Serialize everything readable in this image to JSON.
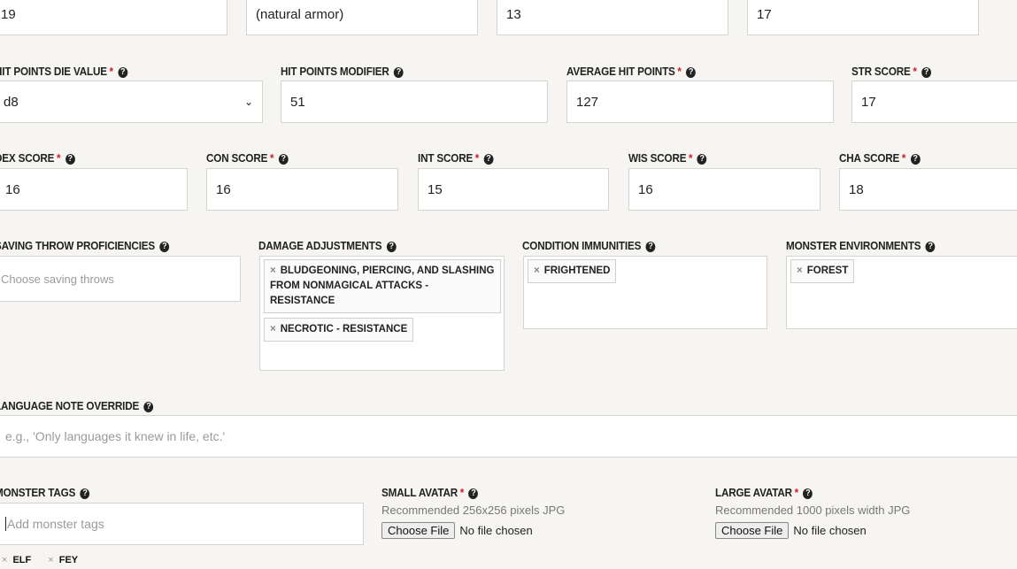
{
  "row0": {
    "values": [
      "19",
      "(natural armor)",
      "13",
      "17"
    ]
  },
  "hit_die": {
    "label": "HIT POINTS DIE VALUE",
    "value": "d8"
  },
  "hp_mod": {
    "label": "HIT POINTS MODIFIER",
    "value": "51"
  },
  "avg_hp": {
    "label": "AVERAGE HIT POINTS",
    "value": "127"
  },
  "str": {
    "label": "STR SCORE",
    "value": "17"
  },
  "dex": {
    "label": "DEX SCORE",
    "value": "16"
  },
  "con": {
    "label": "CON SCORE",
    "value": "16"
  },
  "int": {
    "label": "INT SCORE",
    "value": "15"
  },
  "wis": {
    "label": "WIS SCORE",
    "value": "16"
  },
  "cha": {
    "label": "CHA SCORE",
    "value": "18"
  },
  "saving": {
    "label": "SAVING THROW PROFICIENCIES",
    "placeholder": "Choose saving throws"
  },
  "damage": {
    "label": "DAMAGE ADJUSTMENTS",
    "tags": [
      "BLUDGEONING, PIERCING, AND SLASHING FROM NONMAGICAL ATTACKS - RESISTANCE",
      "NECROTIC - RESISTANCE"
    ]
  },
  "conditions": {
    "label": "CONDITION IMMUNITIES",
    "tags": [
      "FRIGHTENED"
    ]
  },
  "environments": {
    "label": "MONSTER ENVIRONMENTS",
    "tags": [
      "FOREST"
    ]
  },
  "language": {
    "label": "LANGUAGE NOTE OVERRIDE",
    "placeholder": "e.g., 'Only languages it knew in life, etc.'"
  },
  "tags": {
    "label": "MONSTER TAGS",
    "placeholder": "Add monster tags",
    "items": [
      "ELF",
      "FEY"
    ]
  },
  "small_avatar": {
    "label": "SMALL AVATAR",
    "hint": "Recommended 256x256 pixels JPG",
    "button": "Choose File",
    "status": "No file chosen"
  },
  "large_avatar": {
    "label": "LARGE AVATAR",
    "hint": "Recommended 1000 pixels width JPG",
    "button": "Choose File",
    "status": "No file chosen"
  },
  "required_mark": "*",
  "help_icon": "question-circle-icon",
  "remove_icon": "×"
}
